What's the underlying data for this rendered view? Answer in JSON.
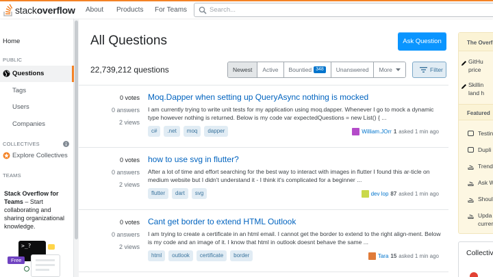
{
  "header": {
    "logo_regular": "stack",
    "logo_bold": "overflow",
    "nav": [
      "About",
      "Products",
      "For Teams"
    ],
    "search_placeholder": "Search..."
  },
  "left_nav": {
    "home": "Home",
    "public_heading": "PUBLIC",
    "items": [
      "Questions",
      "Tags",
      "Users",
      "Companies"
    ],
    "collectives_heading": "COLLECTIVES",
    "explore_collectives": "Explore Collectives",
    "teams_heading": "TEAMS",
    "teams_promo_bold": "Stack Overflow for Teams",
    "teams_promo_rest": " – Start collaborating and sharing organizational knowledge.",
    "free_badge": "Free"
  },
  "main": {
    "title": "All Questions",
    "ask_button": "Ask Question",
    "count": "22,739,212 questions",
    "filters": [
      {
        "label": "Newest",
        "selected": true
      },
      {
        "label": "Active",
        "selected": false
      },
      {
        "label": "Bountied",
        "badge": "348",
        "selected": false
      },
      {
        "label": "Unanswered",
        "selected": false
      },
      {
        "label": "More",
        "selected": false
      }
    ],
    "filter_button": "Filter",
    "questions": [
      {
        "votes": "0 votes",
        "answers": "0 answers",
        "views": "2 views",
        "title": "Moq.Dapper when setting up QueryAsync nothing is mocked",
        "excerpt": "I am currently trying to write unit tests for my application using moq.dapper. Whenever I go to mock a dynamic type however nothing is returned. Below is my code var expectedQuestions = new List() { ...",
        "tags": [
          "c#",
          ".net",
          "moq",
          "dapper"
        ],
        "user": "William.JOrr",
        "rep": "1",
        "asked": "asked 1 min ago",
        "avatar_color": "#b44bc9"
      },
      {
        "votes": "0 votes",
        "answers": "0 answers",
        "views": "2 views",
        "title": "how to use svg in flutter?",
        "excerpt": "After a lot of time and effort searching for the best way to interact with images in flutter I found this ar-ticle on medium website but I didn't understand it - I think it's complicated for a beginner ...",
        "tags": [
          "flutter",
          "dart",
          "svg"
        ],
        "user": "dev lop",
        "rep": "87",
        "asked": "asked 1 min ago",
        "avatar_color": "#c9d94a"
      },
      {
        "votes": "0 votes",
        "answers": "0 answers",
        "views": "2 views",
        "title": "Cant get border to extend HTML Outlook",
        "excerpt": "I am trying to create a certificate in an html email. I cannot get the border to extend to the right align-ment. Below is my code and an image of it. I know that html in outlook doesnt behave the same ...",
        "tags": [
          "html",
          "outlook",
          "certificate",
          "border"
        ],
        "user": "Tara",
        "rep": "15",
        "asked": "asked 1 min ago",
        "avatar_color": "#e07b39"
      }
    ]
  },
  "right_sidebar": {
    "blog_title": "The Overflow",
    "blog_items": [
      "GitHu",
      "price",
      "Skillin",
      "land h"
    ],
    "featured_title": "Featured",
    "featured_items": [
      "Testin",
      "Dupli",
      "Trend",
      "Ask W",
      "Shoul",
      "Upda",
      "curren"
    ],
    "collectives_title": "Collectives"
  },
  "colors": {
    "accent_orange": "#f48225",
    "primary_blue": "#0a95ff",
    "link_blue": "#0063bf",
    "tag_bg": "#e1ecf4"
  }
}
